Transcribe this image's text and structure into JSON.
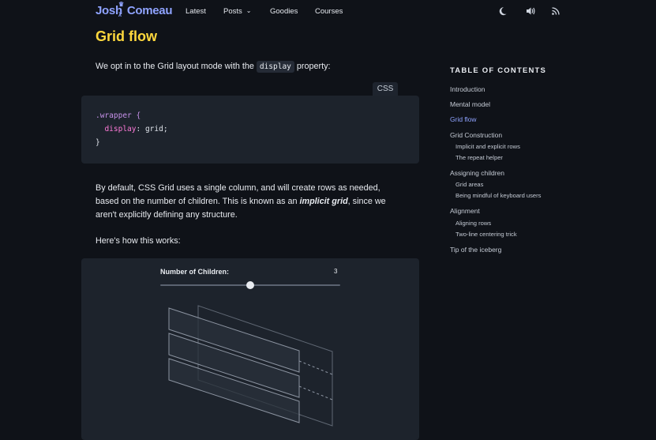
{
  "header": {
    "logo_first": "Josh",
    "logo_last": "Comeau",
    "nav": [
      "Latest",
      "Posts",
      "Goodies",
      "Courses"
    ],
    "icons": [
      "moon-icon",
      "speaker-icon",
      "rss-icon"
    ]
  },
  "article": {
    "heading": "Grid flow",
    "intro_before": "We opt in to the Grid layout mode with the",
    "intro_code": "display",
    "intro_after": "property:",
    "code_language": "CSS",
    "code_lines": [
      ".wrapper {",
      "display",
      ": grid;",
      "}"
    ],
    "para2_a": "By default, CSS Grid uses a single column, and will create rows as needed,",
    "para2_b": "based on the number of children. This is known as an",
    "para2_em": "implicit grid",
    "para2_c": ", since we",
    "para2_d": "aren't explicitly defining any structure.",
    "para3": "Here's how this works:",
    "demo": {
      "slider_label": "Number of Children:",
      "slider_value": "3",
      "slider_fraction": 0.5,
      "rows": 3
    }
  },
  "toc": {
    "title": "TABLE OF CONTENTS",
    "active": "Grid flow",
    "items": [
      {
        "label": "Introduction",
        "level": 1
      },
      {
        "label": "Mental model",
        "level": 1
      },
      {
        "label": "Grid flow",
        "level": 1
      },
      {
        "label": "Grid Construction",
        "level": 1
      },
      {
        "label": "Implicit and explicit rows",
        "level": 2
      },
      {
        "label": "The repeat helper",
        "level": 2
      },
      {
        "label": "Assigning children",
        "level": 1
      },
      {
        "label": "Grid areas",
        "level": 2
      },
      {
        "label": "Being mindful of keyboard users",
        "level": 2
      },
      {
        "label": "Alignment",
        "level": 1
      },
      {
        "label": "Aligning rows",
        "level": 2
      },
      {
        "label": "Two-line centering trick",
        "level": 2
      },
      {
        "label": "Tip of the iceberg",
        "level": 1
      }
    ]
  },
  "colors": {
    "background": "#0f1218",
    "heading": "#ffd83d",
    "accent": "#8fa3ff",
    "panel": "#1d232c"
  }
}
